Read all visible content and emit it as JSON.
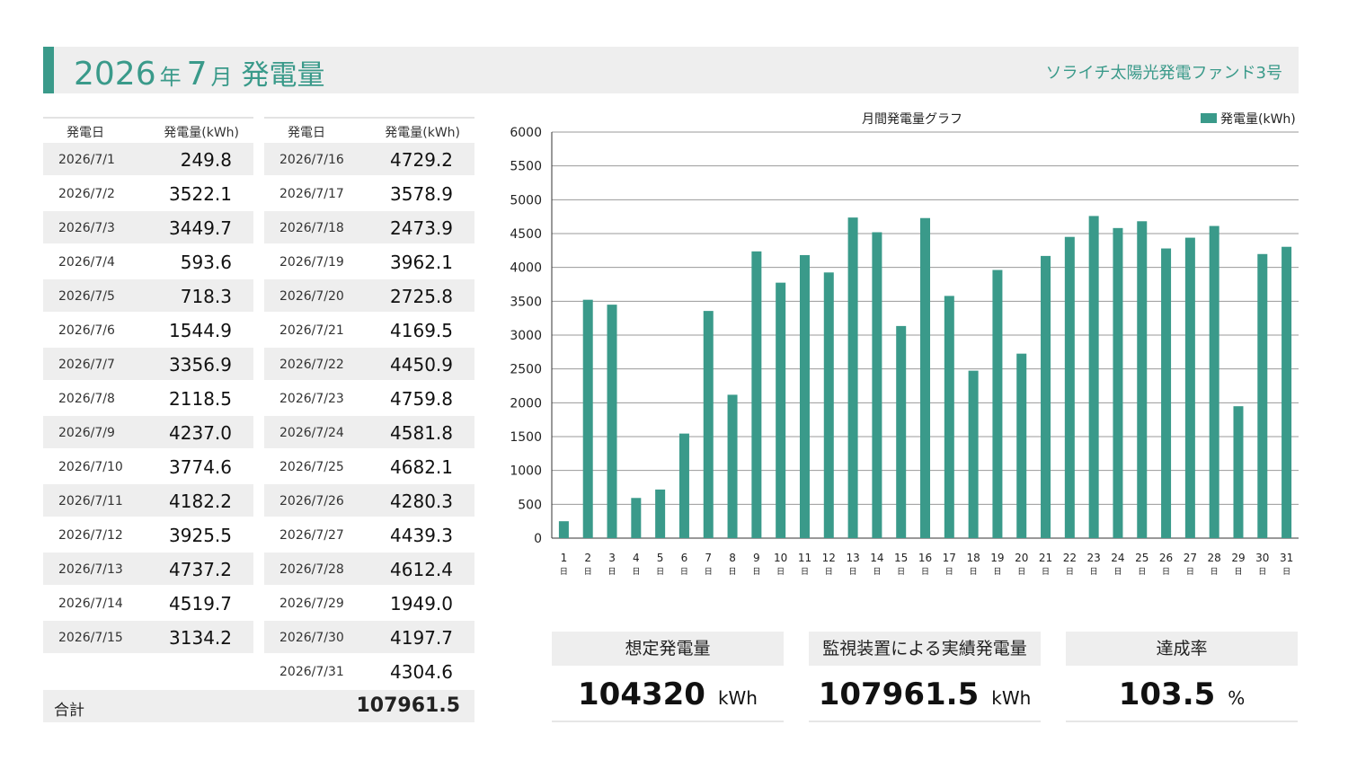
{
  "header": {
    "year": "2026",
    "year_unit": "年",
    "month": "7",
    "month_unit": "月",
    "title": "発電量",
    "fund_name": "ソライチ太陽光発電ファンド3号",
    "accent_color": "#3a9a8a"
  },
  "table": {
    "col_date": "発電日",
    "col_value": "発電量(kWh)",
    "rows_left": [
      {
        "date": "2026/7/1",
        "value": "249.8"
      },
      {
        "date": "2026/7/2",
        "value": "3522.1"
      },
      {
        "date": "2026/7/3",
        "value": "3449.7"
      },
      {
        "date": "2026/7/4",
        "value": "593.6"
      },
      {
        "date": "2026/7/5",
        "value": "718.3"
      },
      {
        "date": "2026/7/6",
        "value": "1544.9"
      },
      {
        "date": "2026/7/7",
        "value": "3356.9"
      },
      {
        "date": "2026/7/8",
        "value": "2118.5"
      },
      {
        "date": "2026/7/9",
        "value": "4237.0"
      },
      {
        "date": "2026/7/10",
        "value": "3774.6"
      },
      {
        "date": "2026/7/11",
        "value": "4182.2"
      },
      {
        "date": "2026/7/12",
        "value": "3925.5"
      },
      {
        "date": "2026/7/13",
        "value": "4737.2"
      },
      {
        "date": "2026/7/14",
        "value": "4519.7"
      },
      {
        "date": "2026/7/15",
        "value": "3134.2"
      }
    ],
    "rows_right": [
      {
        "date": "2026/7/16",
        "value": "4729.2"
      },
      {
        "date": "2026/7/17",
        "value": "3578.9"
      },
      {
        "date": "2026/7/18",
        "value": "2473.9"
      },
      {
        "date": "2026/7/19",
        "value": "3962.1"
      },
      {
        "date": "2026/7/20",
        "value": "2725.8"
      },
      {
        "date": "2026/7/21",
        "value": "4169.5"
      },
      {
        "date": "2026/7/22",
        "value": "4450.9"
      },
      {
        "date": "2026/7/23",
        "value": "4759.8"
      },
      {
        "date": "2026/7/24",
        "value": "4581.8"
      },
      {
        "date": "2026/7/25",
        "value": "4682.1"
      },
      {
        "date": "2026/7/26",
        "value": "4280.3"
      },
      {
        "date": "2026/7/27",
        "value": "4439.3"
      },
      {
        "date": "2026/7/28",
        "value": "4612.4"
      },
      {
        "date": "2026/7/29",
        "value": "1949.0"
      },
      {
        "date": "2026/7/30",
        "value": "4197.7"
      },
      {
        "date": "2026/7/31",
        "value": "4304.6"
      }
    ],
    "total_label": "合計",
    "total_value": "107961.5"
  },
  "summary": {
    "expected": {
      "label": "想定発電量",
      "value": "104320",
      "unit": "kWh"
    },
    "actual": {
      "label": "監視装置による実績発電量",
      "value": "107961.5",
      "unit": "kWh"
    },
    "rate": {
      "label": "達成率",
      "value": "103.5",
      "unit": "%"
    }
  },
  "chart_data": {
    "type": "bar",
    "title": "月間発電量グラフ",
    "legend": "発電量(kWh)",
    "legend_position": "top-right",
    "bar_color": "#3a9a8a",
    "day_suffix": "日",
    "grid": true,
    "ylim": [
      0,
      6000
    ],
    "yticks": [
      0,
      500,
      1000,
      1500,
      2000,
      2500,
      3000,
      3500,
      4000,
      4500,
      5000,
      5500,
      6000
    ],
    "categories": [
      "1",
      "2",
      "3",
      "4",
      "5",
      "6",
      "7",
      "8",
      "9",
      "10",
      "11",
      "12",
      "13",
      "14",
      "15",
      "16",
      "17",
      "18",
      "19",
      "20",
      "21",
      "22",
      "23",
      "24",
      "25",
      "26",
      "27",
      "28",
      "29",
      "30",
      "31"
    ],
    "series": [
      {
        "name": "発電量(kWh)",
        "values": [
          249.8,
          3522.1,
          3449.7,
          593.6,
          718.3,
          1544.9,
          3356.9,
          2118.5,
          4237.0,
          3774.6,
          4182.2,
          3925.5,
          4737.2,
          4519.7,
          3134.2,
          4729.2,
          3578.9,
          2473.9,
          3962.1,
          2725.8,
          4169.5,
          4450.9,
          4759.8,
          4581.8,
          4682.1,
          4280.3,
          4439.3,
          4612.4,
          1949.0,
          4197.7,
          4304.6
        ]
      }
    ]
  }
}
